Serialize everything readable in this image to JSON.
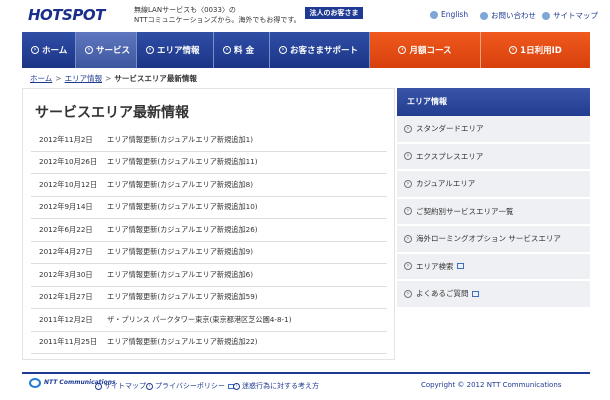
{
  "header": {
    "logo_text": "HOTSPOT",
    "tagline_line1": "無線LANサービスも〈0033〉の",
    "tagline_line2": "NTTコミュニケーションズから。海外でもお得です。",
    "corporate_button": "法人のお客さま",
    "utility": {
      "english": "English",
      "contact": "お問い合わせ",
      "sitemap": "サイトマップ"
    }
  },
  "nav": {
    "home": "ホーム",
    "service": "サービス",
    "area": "エリア情報",
    "price": "料 金",
    "support": "お客さまサポート",
    "monthly": "月額コース",
    "daily": "1日利用ID"
  },
  "breadcrumb": {
    "home": "ホーム",
    "area": "エリア情報",
    "current": "サービスエリア最新情報"
  },
  "main": {
    "title": "サービスエリア最新情報",
    "news": [
      {
        "date": "2012年11月2日",
        "text": "エリア情報更新(カジュアルエリア新規追加1)"
      },
      {
        "date": "2012年10月26日",
        "text": "エリア情報更新(カジュアルエリア新規追加11)"
      },
      {
        "date": "2012年10月12日",
        "text": "エリア情報更新(カジュアルエリア新規追加8)"
      },
      {
        "date": "2012年9月14日",
        "text": "エリア情報更新(カジュアルエリア新規追加10)"
      },
      {
        "date": "2012年6月22日",
        "text": "エリア情報更新(カジュアルエリア新規追加26)"
      },
      {
        "date": "2012年4月27日",
        "text": "エリア情報更新(カジュアルエリア新規追加9)"
      },
      {
        "date": "2012年3月30日",
        "text": "エリア情報更新(カジュアルエリア新規追加6)"
      },
      {
        "date": "2012年1月27日",
        "text": "エリア情報更新(カジュアルエリア新規追加59)"
      },
      {
        "date": "2011年12月2日",
        "text": "ザ・プリンス パークタワー東京(東京都港区芝公園4-8-1)"
      },
      {
        "date": "2011年11月25日",
        "text": "エリア情報更新(カジュアルエリア新規追加22)"
      }
    ]
  },
  "sidebar": {
    "heading": "エリア情報",
    "items": [
      {
        "label": "スタンダードエリア"
      },
      {
        "label": "エクスプレスエリア"
      },
      {
        "label": "カジュアルエリア"
      },
      {
        "label": "ご契約別サービスエリア一覧"
      },
      {
        "label": "海外ローミングオプション サービスエリア"
      },
      {
        "label": "エリア検索"
      },
      {
        "label": "よくあるご質問"
      }
    ]
  },
  "footer": {
    "logo_text": "NTT Communications",
    "sitemap": "サイトマップ",
    "privacy": "プライバシーポリシー",
    "spam": "迷惑行為に対する考え方",
    "copyright": "Copyright © 2012 NTT Communications"
  },
  "colors": {
    "brand_blue": "#1f3a93",
    "accent_orange": "#e8501a",
    "sidebar_bg": "#eef0f4"
  }
}
